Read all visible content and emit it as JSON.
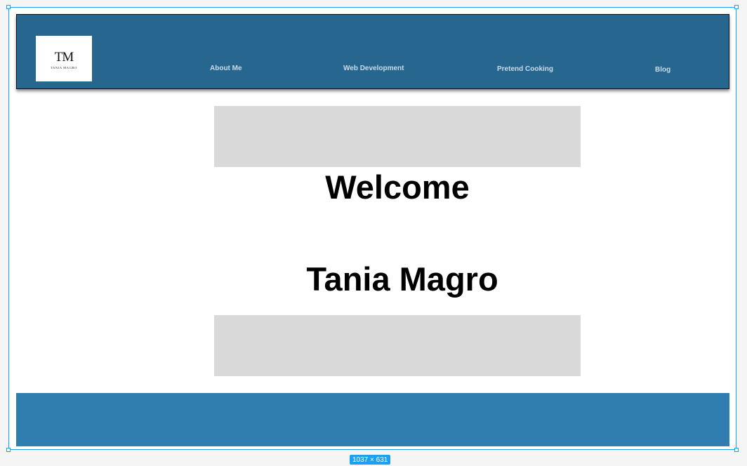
{
  "header": {
    "logo": {
      "mark": "TM",
      "name": "TANIA MAGRO"
    },
    "nav": [
      {
        "label": "About Me"
      },
      {
        "label": "Web Development"
      },
      {
        "label": "Pretend Cooking"
      },
      {
        "label": "Blog"
      }
    ]
  },
  "main": {
    "welcome": "Welcome",
    "name": "Tania Magro"
  },
  "frame": {
    "size_label": "1037 × 631"
  },
  "colors": {
    "header_bg": "#26668f",
    "footer_bg": "#2f7eaf",
    "placeholder_bg": "#d9d9d9",
    "selection_accent": "#1ea0f2"
  }
}
